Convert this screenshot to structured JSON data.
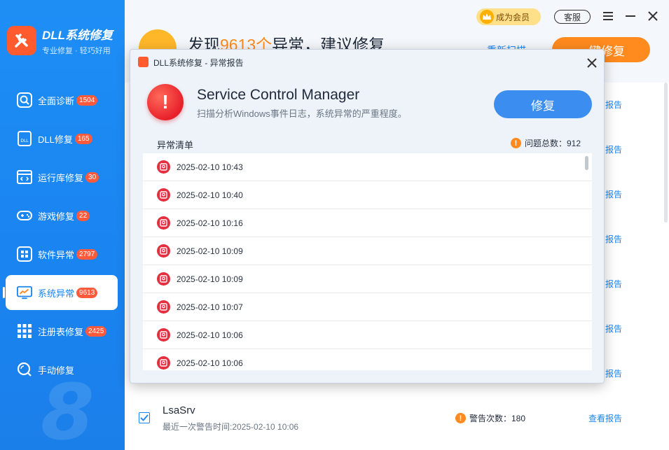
{
  "app": {
    "title": "DLL系统修复",
    "slogan": "专业修复 · 轻巧好用",
    "brand_color": "#1a84f0"
  },
  "sidebar": {
    "items": [
      {
        "label": "全面诊断",
        "badge": "1504",
        "icon": "magnify-icon"
      },
      {
        "label": "DLL修复",
        "badge": "165",
        "icon": "dll-file-icon"
      },
      {
        "label": "运行库修复",
        "badge": "30",
        "icon": "code-window-icon"
      },
      {
        "label": "游戏修复",
        "badge": "22",
        "icon": "gamepad-icon"
      },
      {
        "label": "软件异常",
        "badge": "2797",
        "icon": "apps-icon"
      },
      {
        "label": "系统异常",
        "badge": "9613",
        "icon": "monitor-chart-icon",
        "active": true
      },
      {
        "label": "注册表修复",
        "badge": "2425",
        "icon": "grid-icon"
      },
      {
        "label": "手动修复",
        "badge": "",
        "icon": "search-icon"
      }
    ]
  },
  "topbar": {
    "vip_label": "成为会员",
    "service_label": "客服"
  },
  "main": {
    "title_prefix": "发现",
    "title_count": "9613个",
    "title_suffix": "异常，建议修复",
    "rescan_label": "重新扫描",
    "fix_all_label": "一键修复",
    "side_link": "报告",
    "last_row": {
      "name": "LsaSrv",
      "time": "最近一次警告时间:2025-02-10 10:06",
      "warn": "警告次数：180",
      "view": "查看报告"
    }
  },
  "dialog": {
    "title": "DLL系统修复 - 异常报告",
    "service_name": "Service Control Manager",
    "description": "扫描分析Windows事件日志，系统异常的严重程度。",
    "fix_label": "修复",
    "list_label": "异常清单",
    "total_label": "问题总数：912",
    "entries": [
      "2025-02-10 10:43",
      "2025-02-10 10:40",
      "2025-02-10 10:16",
      "2025-02-10 10:09",
      "2025-02-10 10:09",
      "2025-02-10 10:07",
      "2025-02-10 10:06",
      "2025-02-10 10:06"
    ]
  }
}
